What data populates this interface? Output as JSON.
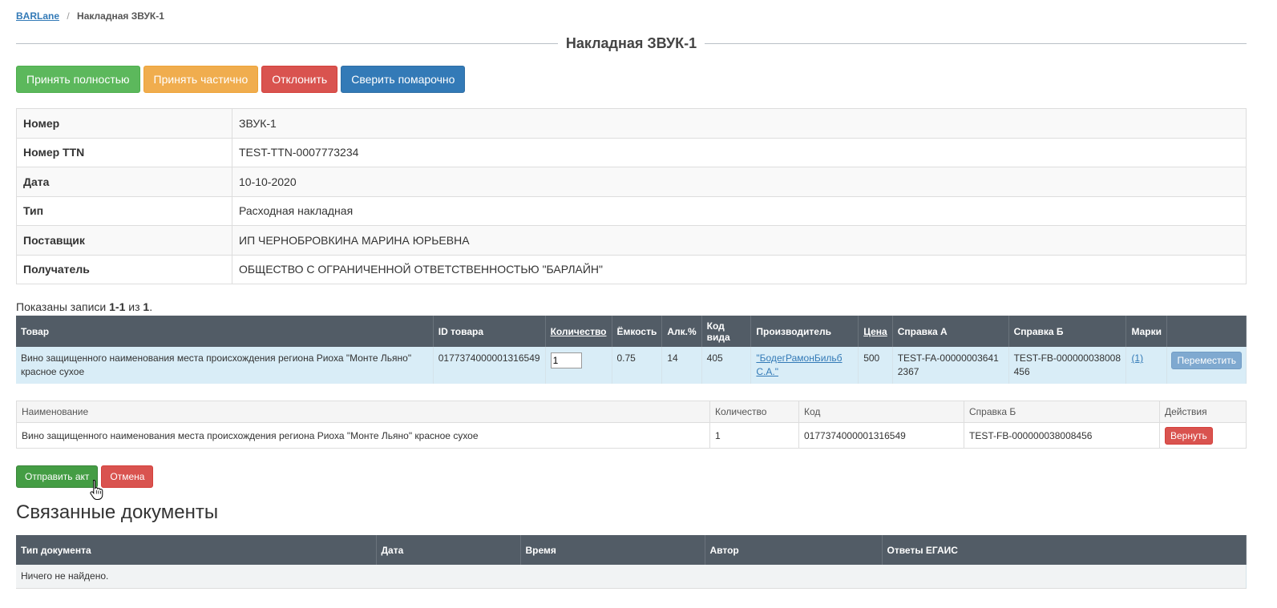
{
  "breadcrumb": {
    "home": "BARLane",
    "separator": "/",
    "current": "Накладная ЗВУК-1"
  },
  "page_title": "Накладная ЗВУК-1",
  "actions": {
    "accept_full": "Принять полностью",
    "accept_partial": "Принять частично",
    "reject": "Отклонить",
    "reconcile": "Сверить помарочно"
  },
  "details": [
    {
      "key": "Номер",
      "value": "ЗВУК-1"
    },
    {
      "key": "Номер TTN",
      "value": "TEST-TTN-0007773234"
    },
    {
      "key": "Дата",
      "value": "10-10-2020"
    },
    {
      "key": "Тип",
      "value": "Расходная накладная"
    },
    {
      "key": "Поставщик",
      "value": "ИП ЧЕРНОБРОВКИНА МАРИНА ЮРЬЕВНА"
    },
    {
      "key": "Получатель",
      "value": "ОБЩЕСТВО С ОГРАНИЧЕННОЙ ОТВЕТСТВЕННОСТЬЮ \"БАРЛАЙН\""
    }
  ],
  "summary": {
    "prefix": "Показаны записи ",
    "range": "1-1",
    "middle": " из ",
    "total": "1",
    "suffix": "."
  },
  "items_table": {
    "headers": {
      "product": "Товар",
      "product_id": "ID товара",
      "quantity": "Количество",
      "capacity": "Ёмкость",
      "alc": "Алк.%",
      "kind_code": "Код вида",
      "producer": "Производитель",
      "price": "Цена",
      "ref_a": "Справка А",
      "ref_b": "Справка Б",
      "marks": "Марки"
    },
    "row": {
      "product": "Вино защищенного наименования места происхождения региона Риоха \"Монте Льяно\" красное сухое",
      "product_id": "0177374000001316549",
      "quantity_value": "1",
      "capacity": "0.75",
      "alc": "14",
      "kind_code": "405",
      "producer": "\"БодегРамонБильб С.А.\"",
      "price": "500",
      "ref_a": "TEST-FA-000000036412367",
      "ref_b": "TEST-FB-000000038008456",
      "marks_link": "(1)",
      "move_button": "Переместить"
    }
  },
  "act_table": {
    "headers": {
      "name": "Наименование",
      "quantity": "Количество",
      "code": "Код",
      "ref_b": "Справка Б",
      "actions": "Действия"
    },
    "row": {
      "name": "Вино защищенного наименования места происхождения региона Риоха \"Монте Льяно\" красное сухое",
      "quantity": "1",
      "code": "0177374000001316549",
      "ref_b": "TEST-FB-000000038008456",
      "return_button": "Вернуть"
    }
  },
  "act_buttons": {
    "send": "Отправить акт",
    "cancel": "Отмена"
  },
  "related": {
    "heading": "Связанные документы",
    "headers": {
      "doc_type": "Тип документа",
      "date": "Дата",
      "time": "Время",
      "author": "Автор",
      "egais": "Ответы ЕГАИС"
    },
    "empty": "Ничего не найдено."
  },
  "icons": {
    "cursor": "hand-pointer-icon"
  },
  "colors": {
    "success": "#5cb85c",
    "warning": "#f0ad4e",
    "danger": "#d9534f",
    "primary": "#337ab7",
    "table_header": "#525c66",
    "row_highlight": "#d9edf7"
  }
}
